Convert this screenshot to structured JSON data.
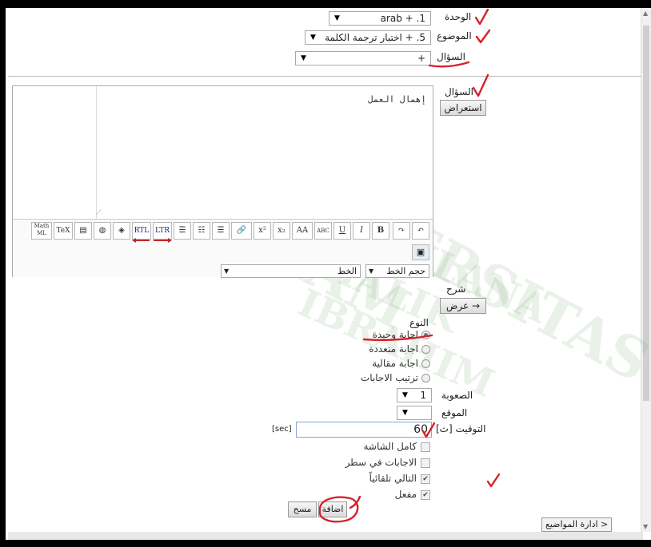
{
  "header": {
    "unit_label": "الوحدة",
    "unit_value": "1. + arab",
    "topic_label": "الموضوع",
    "topic_value": "5. + اختبار ترجمة الكلمة",
    "question_label": "السؤال",
    "question_value": "+"
  },
  "question_section": {
    "label": "السؤال",
    "browse_button": "استعراض",
    "editor_text": "إهمال العمل"
  },
  "toolbar": {
    "buttons": [
      "↶",
      "↷",
      "B",
      "I",
      "U",
      "ABC",
      "AA",
      "x₂",
      "x²",
      "🔗",
      "☰",
      "☷",
      "☰",
      "LTR",
      "RTL",
      "◈",
      "◍",
      "▤",
      "TeX",
      "Math ML"
    ],
    "row2_button": "▣",
    "font_size_label": "حجم الخط",
    "font_label": "الخط"
  },
  "explanation": {
    "label": "شرح",
    "button": "عرض →"
  },
  "type_section": {
    "label": "النوع",
    "options": [
      {
        "label": "اجابة وحيدة",
        "checked": true
      },
      {
        "label": "اجابة متعددة",
        "checked": false
      },
      {
        "label": "اجابة مقالية",
        "checked": false
      },
      {
        "label": "ترتيب الاجابات",
        "checked": false
      }
    ]
  },
  "difficulty": {
    "label": "الصعوبة",
    "value": "1"
  },
  "position": {
    "label": "الموقع",
    "value": ""
  },
  "timer": {
    "label": "التوقيت [ث]",
    "value": "60",
    "unit": "[sec]"
  },
  "checkboxes": [
    {
      "label": "كامل الشاشة",
      "checked": false
    },
    {
      "label": "الاجابات في سطر",
      "checked": false
    },
    {
      "label": "التالي تلقائياً",
      "checked": true
    },
    {
      "label": "مفعل",
      "checked": true
    }
  ],
  "actions": {
    "add": "اضافة",
    "clear": "مسح"
  },
  "bottom_nav": "< ادارة المواضيع",
  "colors": {
    "annotation": "#d8202a",
    "frame": "#000000"
  }
}
